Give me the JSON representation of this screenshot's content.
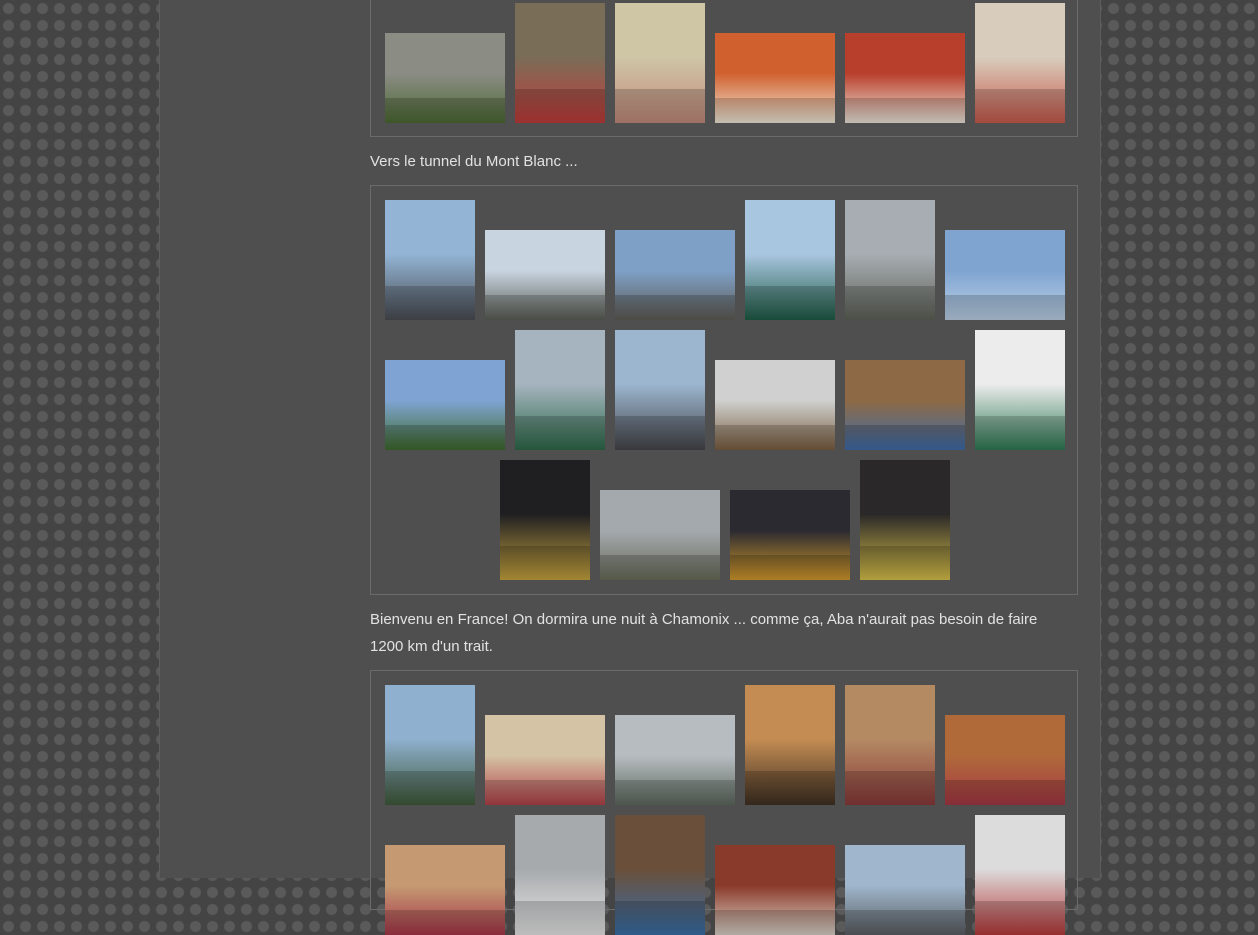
{
  "captions": {
    "tunnel": "Vers le tunnel du Mont Blanc ...",
    "france": "Bienvenu en France! On dormira une nuit à Chamonix ... comme ça, Aba n'aurait pas besoin de faire 1200 km d'un trait."
  },
  "galleries": [
    {
      "name": "gallery-intro",
      "photos": [
        {
          "name": "photo-flower-shop",
          "colors": [
            "#8b8c84",
            "#4d6a34"
          ]
        },
        {
          "name": "photo-street-poster",
          "colors": [
            "#7a6d57",
            "#c03c3c"
          ]
        },
        {
          "name": "photo-map-finger",
          "colors": [
            "#cfc6a6",
            "#c28a7b"
          ]
        },
        {
          "name": "photo-lunch-tray",
          "colors": [
            "#d0612f",
            "#f0e8d8"
          ]
        },
        {
          "name": "photo-lunch-plates",
          "colors": [
            "#b83f2c",
            "#ece6da"
          ]
        },
        {
          "name": "photo-road-map",
          "colors": [
            "#d8cdbd",
            "#c85a4c"
          ]
        }
      ]
    },
    {
      "name": "gallery-tunnel",
      "photos": [
        {
          "name": "photo-bridge-highway",
          "colors": [
            "#93b4d5",
            "#4a4d52"
          ]
        },
        {
          "name": "photo-valley-mountains",
          "colors": [
            "#c8d4e0",
            "#5b5e55"
          ]
        },
        {
          "name": "photo-clouds-highway",
          "colors": [
            "#7ea0c7",
            "#5f5c54"
          ]
        },
        {
          "name": "photo-aosta-sign",
          "colors": [
            "#a9c6e0",
            "#1f5c46"
          ]
        },
        {
          "name": "photo-cloudy-road",
          "colors": [
            "#a8adb3",
            "#5d6257"
          ]
        },
        {
          "name": "photo-sky-cloud",
          "colors": [
            "#7fa4d0",
            "#bcd0e6"
          ]
        },
        {
          "name": "photo-corn-field",
          "colors": [
            "#7fa4d3",
            "#3e6a2c"
          ]
        },
        {
          "name": "photo-ivrea-sign",
          "colors": [
            "#a6b4bf",
            "#2d6a4a"
          ]
        },
        {
          "name": "photo-mountain-road",
          "colors": [
            "#9cb6d0",
            "#45464a"
          ]
        },
        {
          "name": "photo-tunnel-entrance",
          "colors": [
            "#cfd0cf",
            "#7a5e40"
          ]
        },
        {
          "name": "photo-border-sign",
          "colors": [
            "#8d6a45",
            "#3f6ca9"
          ]
        },
        {
          "name": "photo-mont-blanc-sign",
          "colors": [
            "#ececec",
            "#2e7a54"
          ]
        },
        {
          "name": "photo-tunnel-lights",
          "colors": [
            "#1f1f22",
            "#c7a43f"
          ]
        },
        {
          "name": "photo-flags",
          "colors": [
            "#a4a9ae",
            "#6a6d5a"
          ]
        },
        {
          "name": "photo-radio-sign",
          "colors": [
            "#2a2a30",
            "#d49a2c"
          ]
        },
        {
          "name": "photo-tunnel-inside",
          "colors": [
            "#2a2828",
            "#d9c14a"
          ]
        }
      ]
    },
    {
      "name": "gallery-chamonix",
      "photos": [
        {
          "name": "photo-hill-village",
          "colors": [
            "#8fb0cf",
            "#3f5a3a"
          ]
        },
        {
          "name": "photo-hotel-bed",
          "colors": [
            "#d5c3a5",
            "#b3424a"
          ]
        },
        {
          "name": "photo-chamonix-town",
          "colors": [
            "#b7bcc1",
            "#5e6a5e"
          ]
        },
        {
          "name": "photo-wooden-stairs",
          "colors": [
            "#c48c53",
            "#3f3023"
          ]
        },
        {
          "name": "photo-bunk-room",
          "colors": [
            "#b48a63",
            "#8a3a3a"
          ]
        },
        {
          "name": "photo-room-top-view",
          "colors": [
            "#b06a3a",
            "#a53845"
          ]
        },
        {
          "name": "photo-bed-relax",
          "colors": [
            "#c59a73",
            "#a8384a"
          ]
        },
        {
          "name": "photo-glacier",
          "colors": [
            "#a7aaad",
            "#e6e6e6"
          ]
        },
        {
          "name": "photo-postcards",
          "colors": [
            "#6a4f3a",
            "#3a6fa8"
          ]
        },
        {
          "name": "photo-balcony-view",
          "colors": [
            "#8a3a2a",
            "#d9d2c8"
          ]
        },
        {
          "name": "photo-mountain-peaks",
          "colors": [
            "#9fb6cc",
            "#5b5f63"
          ]
        },
        {
          "name": "photo-tshirt-shop",
          "colors": [
            "#dcdcdc",
            "#b73a3a"
          ]
        }
      ]
    }
  ]
}
